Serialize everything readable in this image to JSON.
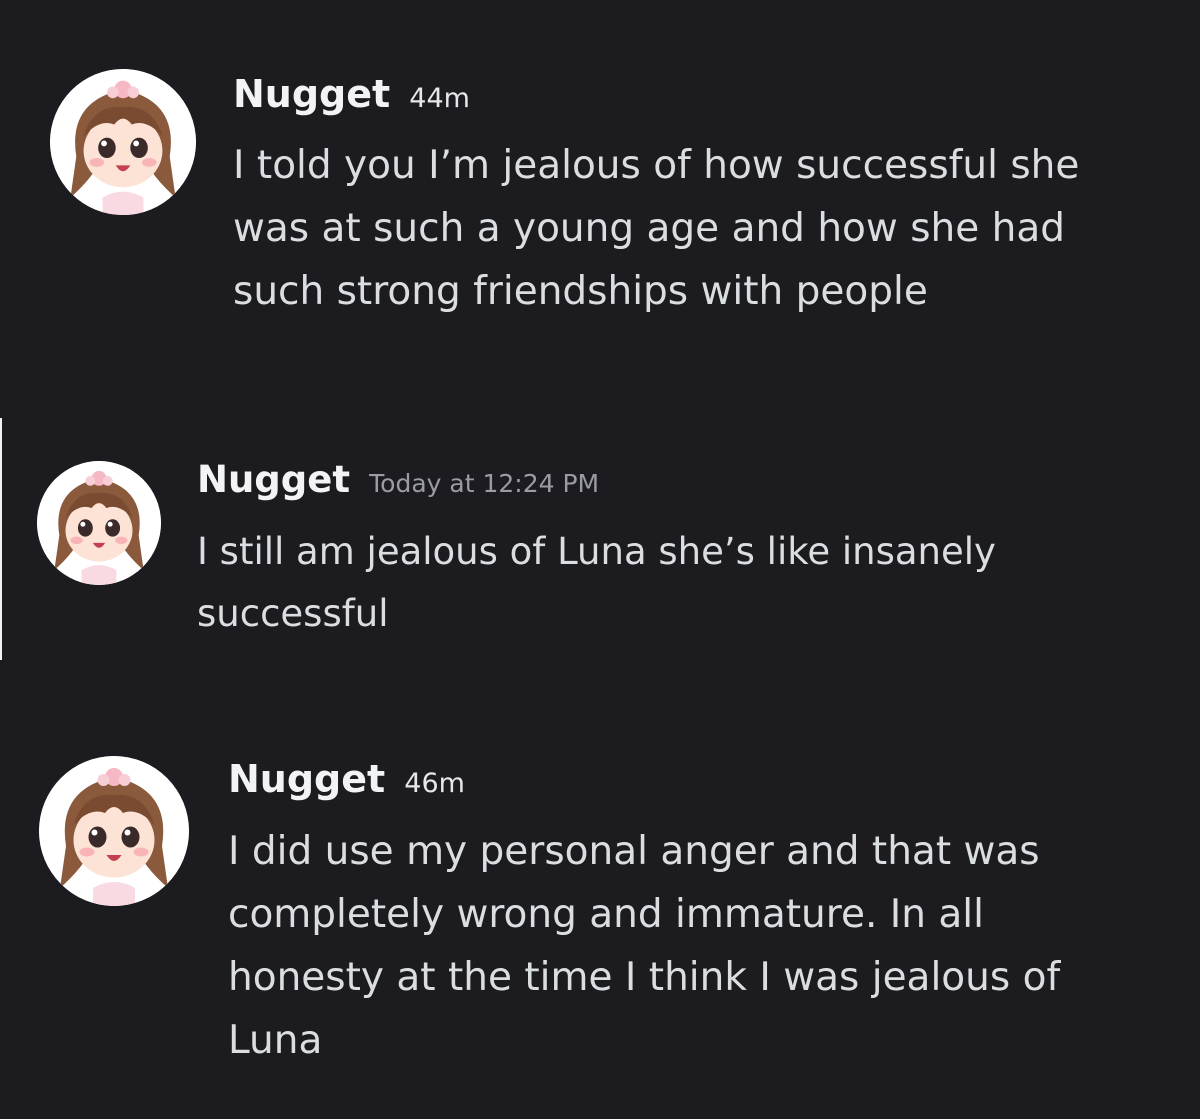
{
  "messages": [
    {
      "author": "Nugget",
      "timestamp": "44m",
      "text": "I told you I’m jealous of how successful she was at such a young age and how she had such strong friendships with people",
      "avatar": "anime-avatar-icon"
    },
    {
      "author": "Nugget",
      "timestamp": "Today at 12:24 PM",
      "text": "I still am jealous of Luna she’s like insanely successful",
      "avatar": "anime-avatar-icon"
    },
    {
      "author": "Nugget",
      "timestamp": "46m",
      "text": "I did use my personal anger and that was completely wrong and immature. In all honesty at the time I think I was jealous of Luna",
      "avatar": "anime-avatar-icon"
    }
  ],
  "colors": {
    "background": "#1b1b20",
    "author": "#f2f3f5",
    "message_text": "#dbdee1",
    "timestamp_muted": "#9a9ca3"
  }
}
